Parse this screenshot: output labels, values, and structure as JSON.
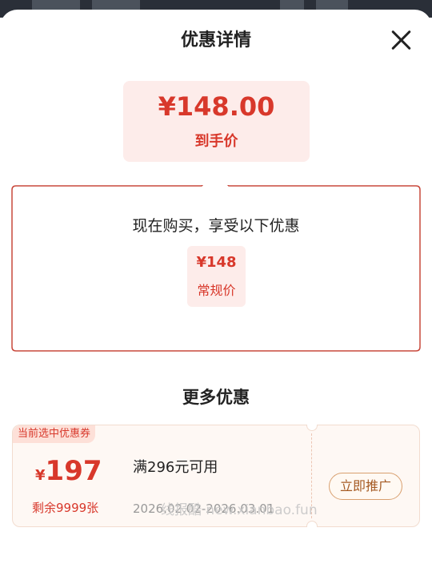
{
  "header": {
    "title": "优惠详情"
  },
  "final_price": {
    "amount": "¥148.00",
    "label": "到手价"
  },
  "discount_section": {
    "intro": "现在购买，享受以下优惠",
    "regular_price": "¥148",
    "regular_label": "常规价"
  },
  "more_offers": {
    "title": "更多优惠"
  },
  "coupon": {
    "badge": "当前选中优惠券",
    "currency": "¥",
    "amount": "197",
    "remaining": "剩余9999张",
    "condition": "满296元可用",
    "valid_dates": "2026.02.02-2026.03.01",
    "promote_button": "立即推广"
  },
  "watermark": "线报酷 new.xianbao.fun",
  "colors": {
    "accent": "#d8382b",
    "accent_bg": "#fdecea",
    "coupon_bg": "#fef8f4",
    "button_border": "#d9a070"
  }
}
